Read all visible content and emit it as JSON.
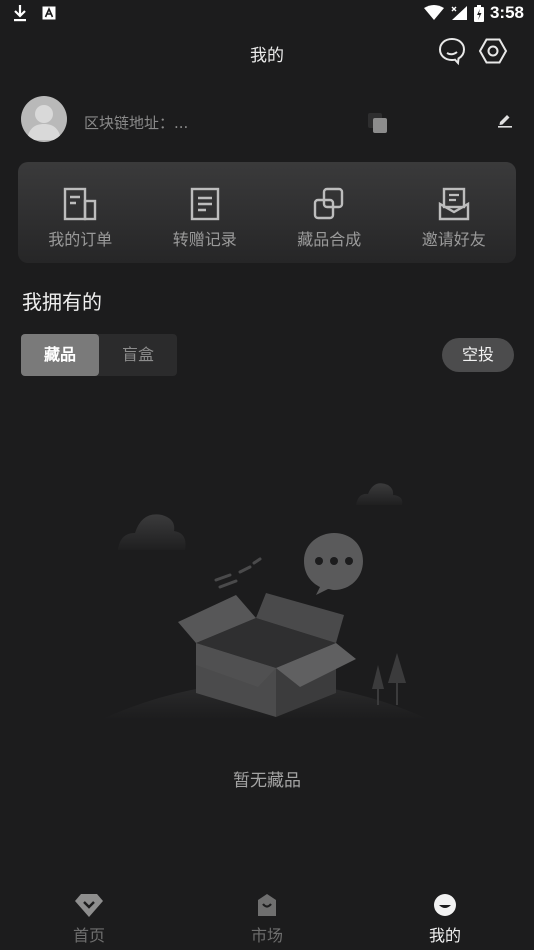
{
  "status_bar": {
    "time": "3:58",
    "icons": [
      "download-icon",
      "font-icon",
      "wifi-icon",
      "signal-icon",
      "battery-icon"
    ]
  },
  "header": {
    "title": "我的",
    "icons": [
      "chat-bubble-icon",
      "settings-hexagon-icon"
    ]
  },
  "profile": {
    "chain_address_label": "区块链地址：...",
    "icons": [
      "avatar-icon",
      "copy-icon",
      "edit-icon"
    ]
  },
  "quick_actions": [
    {
      "label": "我的订单",
      "icon": "orders-icon"
    },
    {
      "label": "转赠记录",
      "icon": "transfer-record-icon"
    },
    {
      "label": "藏品合成",
      "icon": "synthesis-icon"
    },
    {
      "label": "邀请好友",
      "icon": "invite-icon"
    }
  ],
  "section": {
    "title": "我拥有的",
    "tabs": [
      {
        "label": "藏品",
        "active": true
      },
      {
        "label": "盲盒",
        "active": false
      }
    ],
    "airdrop_label": "空投"
  },
  "empty_state": {
    "text": "暂无藏品"
  },
  "bottom_nav": [
    {
      "label": "首页",
      "icon": "home-diamond-icon",
      "active": false
    },
    {
      "label": "市场",
      "icon": "market-bag-icon",
      "active": false
    },
    {
      "label": "我的",
      "icon": "profile-face-icon",
      "active": true
    }
  ],
  "colors": {
    "background": "#1c1c1d",
    "card_top": "#3a3a3b",
    "tab_active": "#7a7a7a",
    "airdrop_button": "#4c4c4d"
  }
}
